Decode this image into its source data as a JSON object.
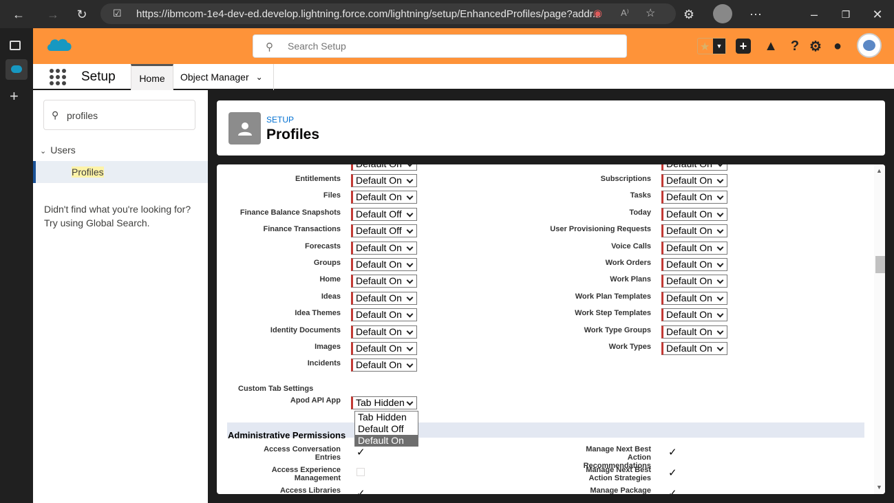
{
  "browser": {
    "url": "https://ibmcom-1e4-dev-ed.develop.lightning.force.com/lightning/setup/EnhancedProfiles/page?addr...",
    "read_aloud": "A⁾"
  },
  "header": {
    "search_placeholder": "Search Setup"
  },
  "nav": {
    "title": "Setup",
    "tabs": [
      "Home",
      "Object Manager"
    ]
  },
  "sidebar": {
    "quickfind_value": "profiles",
    "tree_group": "Users",
    "tree_item": "Profiles",
    "not_found": "Didn't find what you're looking for? Try using Global Search."
  },
  "page": {
    "breadcrumb": "SETUP",
    "title": "Profiles"
  },
  "tab_settings": {
    "partial_value": "Default On",
    "left": [
      {
        "label": "Entitlements",
        "value": "Default On"
      },
      {
        "label": "Files",
        "value": "Default On"
      },
      {
        "label": "Finance Balance Snapshots",
        "value": "Default Off"
      },
      {
        "label": "Finance Transactions",
        "value": "Default Off"
      },
      {
        "label": "Forecasts",
        "value": "Default On"
      },
      {
        "label": "Groups",
        "value": "Default On"
      },
      {
        "label": "Home",
        "value": "Default On"
      },
      {
        "label": "Ideas",
        "value": "Default On"
      },
      {
        "label": "Idea Themes",
        "value": "Default On"
      },
      {
        "label": "Identity Documents",
        "value": "Default On"
      },
      {
        "label": "Images",
        "value": "Default On"
      },
      {
        "label": "Incidents",
        "value": "Default On"
      }
    ],
    "right": [
      {
        "label": "Subscriptions",
        "value": "Default On"
      },
      {
        "label": "Tasks",
        "value": "Default On"
      },
      {
        "label": "Today",
        "value": "Default On"
      },
      {
        "label": "User Provisioning Requests",
        "value": "Default On"
      },
      {
        "label": "Voice Calls",
        "value": "Default On"
      },
      {
        "label": "Work Orders",
        "value": "Default On"
      },
      {
        "label": "Work Plans",
        "value": "Default On"
      },
      {
        "label": "Work Plan Templates",
        "value": "Default On"
      },
      {
        "label": "Work Step Templates",
        "value": "Default On"
      },
      {
        "label": "Work Type Groups",
        "value": "Default On"
      },
      {
        "label": "Work Types",
        "value": "Default On"
      }
    ]
  },
  "custom_tab": {
    "heading": "Custom Tab Settings",
    "label": "Apod API App",
    "value": "Tab Hidden",
    "options": [
      "Tab Hidden",
      "Default Off",
      "Default On"
    ],
    "highlighted_option": "Default On"
  },
  "admin": {
    "title": "Administrative Permissions",
    "left": [
      {
        "label": "Access Conversation Entries",
        "checked": true
      },
      {
        "label": "Access Experience Management",
        "checked": false
      },
      {
        "label": "Access Libraries",
        "checked": true
      }
    ],
    "right": [
      {
        "label": "Manage Next Best Action Recommendations",
        "checked": true
      },
      {
        "label": "Manage Next Best Action Strategies",
        "checked": true
      },
      {
        "label": "Manage Package Licenses",
        "checked": true
      }
    ]
  },
  "colors": {
    "brand_header": "#fe9339",
    "required_bar": "#c23934",
    "link": "#0070d2"
  }
}
